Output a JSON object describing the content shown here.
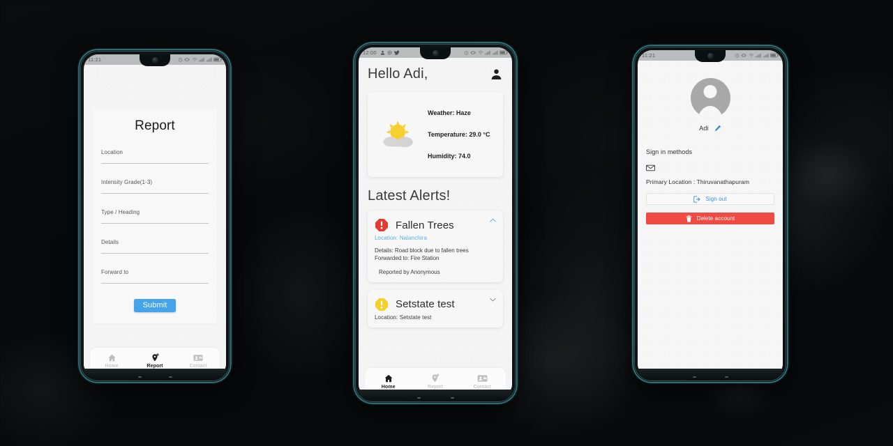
{
  "phone1": {
    "status_bar": {
      "time": "11:21",
      "icons": [
        "alarm-icon",
        "vibrate-icon",
        "wifi-icon",
        "signal-icon",
        "signal2-icon",
        "battery-icon"
      ]
    },
    "screen_name": "report-screen",
    "form": {
      "title": "Report",
      "fields": [
        {
          "label": "Location",
          "value": "",
          "name": "location-field"
        },
        {
          "label": "Intensity Grade(1-3)",
          "value": "",
          "name": "intensity-field"
        },
        {
          "label": "Type / Heading",
          "value": "",
          "name": "type-heading-field"
        },
        {
          "label": "Details",
          "value": "",
          "name": "details-field"
        },
        {
          "label": "Forward to",
          "value": "",
          "name": "forward-to-field"
        }
      ],
      "submit_label": "Submit",
      "submit_color": "#44a3eb"
    },
    "bottom_nav": [
      {
        "label": "Home",
        "icon": "home-icon",
        "active": false
      },
      {
        "label": "Report",
        "icon": "add-location-icon",
        "active": true
      },
      {
        "label": "Contact",
        "icon": "contact-card-icon",
        "active": false
      }
    ]
  },
  "phone2": {
    "status_bar": {
      "time": "12:00",
      "icons": [
        "person-notification-icon",
        "settings-notification-icon",
        "twitter-notification-icon",
        "alarm-icon",
        "vibrate-icon",
        "wifi-icon",
        "signal-icon",
        "signal2-icon",
        "battery-icon"
      ]
    },
    "screen_name": "home-screen",
    "header": {
      "greeting": "Hello Adi,",
      "profile_icon": "person-icon"
    },
    "weather": {
      "icon": "sun-behind-cloud-icon",
      "lines": [
        "Weather: Haze",
        "Temperature: 29.0 °C",
        "Humidity: 74.0"
      ]
    },
    "alerts_title": "Latest Alerts!",
    "alerts": [
      {
        "severity_icon": "alert-octagon-red-icon",
        "severity_color": "#e23b32",
        "title": "Fallen Trees",
        "location": "Location: Nalanchira",
        "details": "Details: Road block due to fallen trees",
        "forwarded": "Forwarded to: Fire Station",
        "reported_by": "Reported by Anonymous",
        "expanded": true,
        "chevron": "chevron-up-icon"
      },
      {
        "severity_icon": "alert-octagon-yellow-icon",
        "severity_color": "#f5cf2a",
        "title": "Setstate test",
        "location": "Location: Setstate test",
        "details": "",
        "forwarded": "",
        "reported_by": "",
        "expanded": false,
        "chevron": "chevron-down-icon"
      }
    ],
    "bottom_nav": [
      {
        "label": "Home",
        "icon": "home-icon",
        "active": true
      },
      {
        "label": "Report",
        "icon": "add-location-icon",
        "active": false
      },
      {
        "label": "Contact",
        "icon": "contact-card-icon",
        "active": false
      }
    ]
  },
  "phone3": {
    "status_bar": {
      "time": "11:21",
      "icons": [
        "alarm-icon",
        "vibrate-icon",
        "wifi-icon",
        "signal-icon",
        "signal2-icon",
        "battery-icon"
      ]
    },
    "screen_name": "profile-screen",
    "avatar_icon": "avatar-placeholder-icon",
    "user_name": "Adi",
    "edit_icon": "pencil-icon",
    "sign_in_methods_label": "Sign in methods",
    "email_icon": "envelope-icon",
    "primary_location": "Primary Location : Thiruvanathapuram",
    "sign_out": {
      "label": "Sign out",
      "icon": "sign-out-icon",
      "color": "#3b8fd6"
    },
    "delete_account": {
      "label": "Delete account",
      "icon": "trash-icon",
      "color": "#ef4b43"
    }
  }
}
